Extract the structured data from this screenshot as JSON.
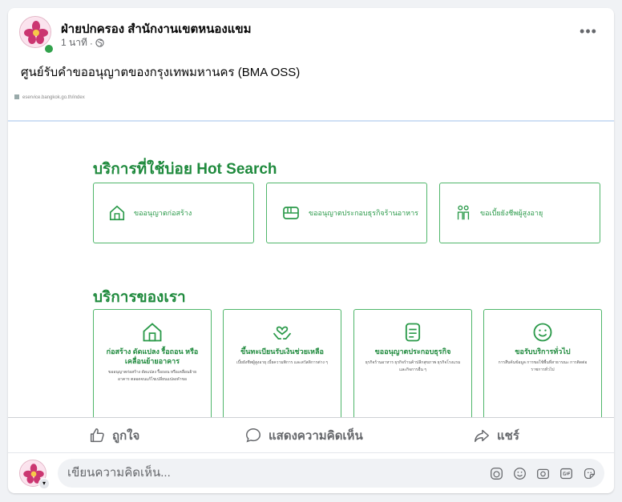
{
  "post": {
    "author": "ฝ่ายปกครอง สำนักงานเขตหนองแขม",
    "time": "1 นาที",
    "separator": "·",
    "text": "ศูนย์รับคำขออนุญาตของกรุงเทพมหานคร (BMA OSS)",
    "more_label": "•••"
  },
  "shared_page": {
    "url": "eservice.bangkok.go.th/index",
    "hot_title": "บริการที่ใช้บ่อย Hot Search",
    "hot_items": [
      {
        "label": "ขออนุญาตก่อสร้าง",
        "icon": "house-icon"
      },
      {
        "label": "ขออนุญาตประกอบธุรกิจร้านอาหาร",
        "icon": "restaurant-icon"
      },
      {
        "label": "ขอเบี้ยยังชีพผู้สูงอายุ",
        "icon": "elderly-icon"
      }
    ],
    "services_title": "บริการของเรา",
    "services": [
      {
        "title": "ก่อสร้าง ดัดแปลง รื้อถอน หรือเคลื่อนย้ายอาคาร",
        "desc": "ขออนุญาตก่อสร้าง ดัดแปลง รื้อถอน หรือเคลื่อนย้ายอาคาร ตลอดจนแก้ไขเปลี่ยนแปลงคำขอ",
        "icon": "house-icon"
      },
      {
        "title": "ขึ้นทะเบียนรับเงินช่วยเหลือ",
        "desc": "เบี้ยยังชีพผู้สูงอายุ เบี้ยความพิการ และสวัสดิการต่าง ๆ",
        "icon": "hands-heart-icon"
      },
      {
        "title": "ขออนุญาตประกอบธุรกิจ",
        "desc": "ธุรกิจร้านอาหาร ธุรกิจร้านค้าปลีกสุขภาพ ธุรกิจโรงแรมและกิจการอื่น ๆ",
        "icon": "document-icon"
      },
      {
        "title": "ขอรับบริการทั่วไป",
        "desc": "การสืบค้นข้อมูล การขอใช้พื้นที่สาธารณะ การติดต่อราชการทั่วไป",
        "icon": "smile-icon"
      }
    ]
  },
  "actions": {
    "like": "ถูกใจ",
    "comment": "แสดงความคิดเห็น",
    "share": "แชร์"
  },
  "comment_box": {
    "placeholder": "เขียนความคิดเห็น..."
  },
  "colors": {
    "green": "#1f8a3d",
    "border_green": "#4fb66a",
    "muted": "#65676b"
  }
}
